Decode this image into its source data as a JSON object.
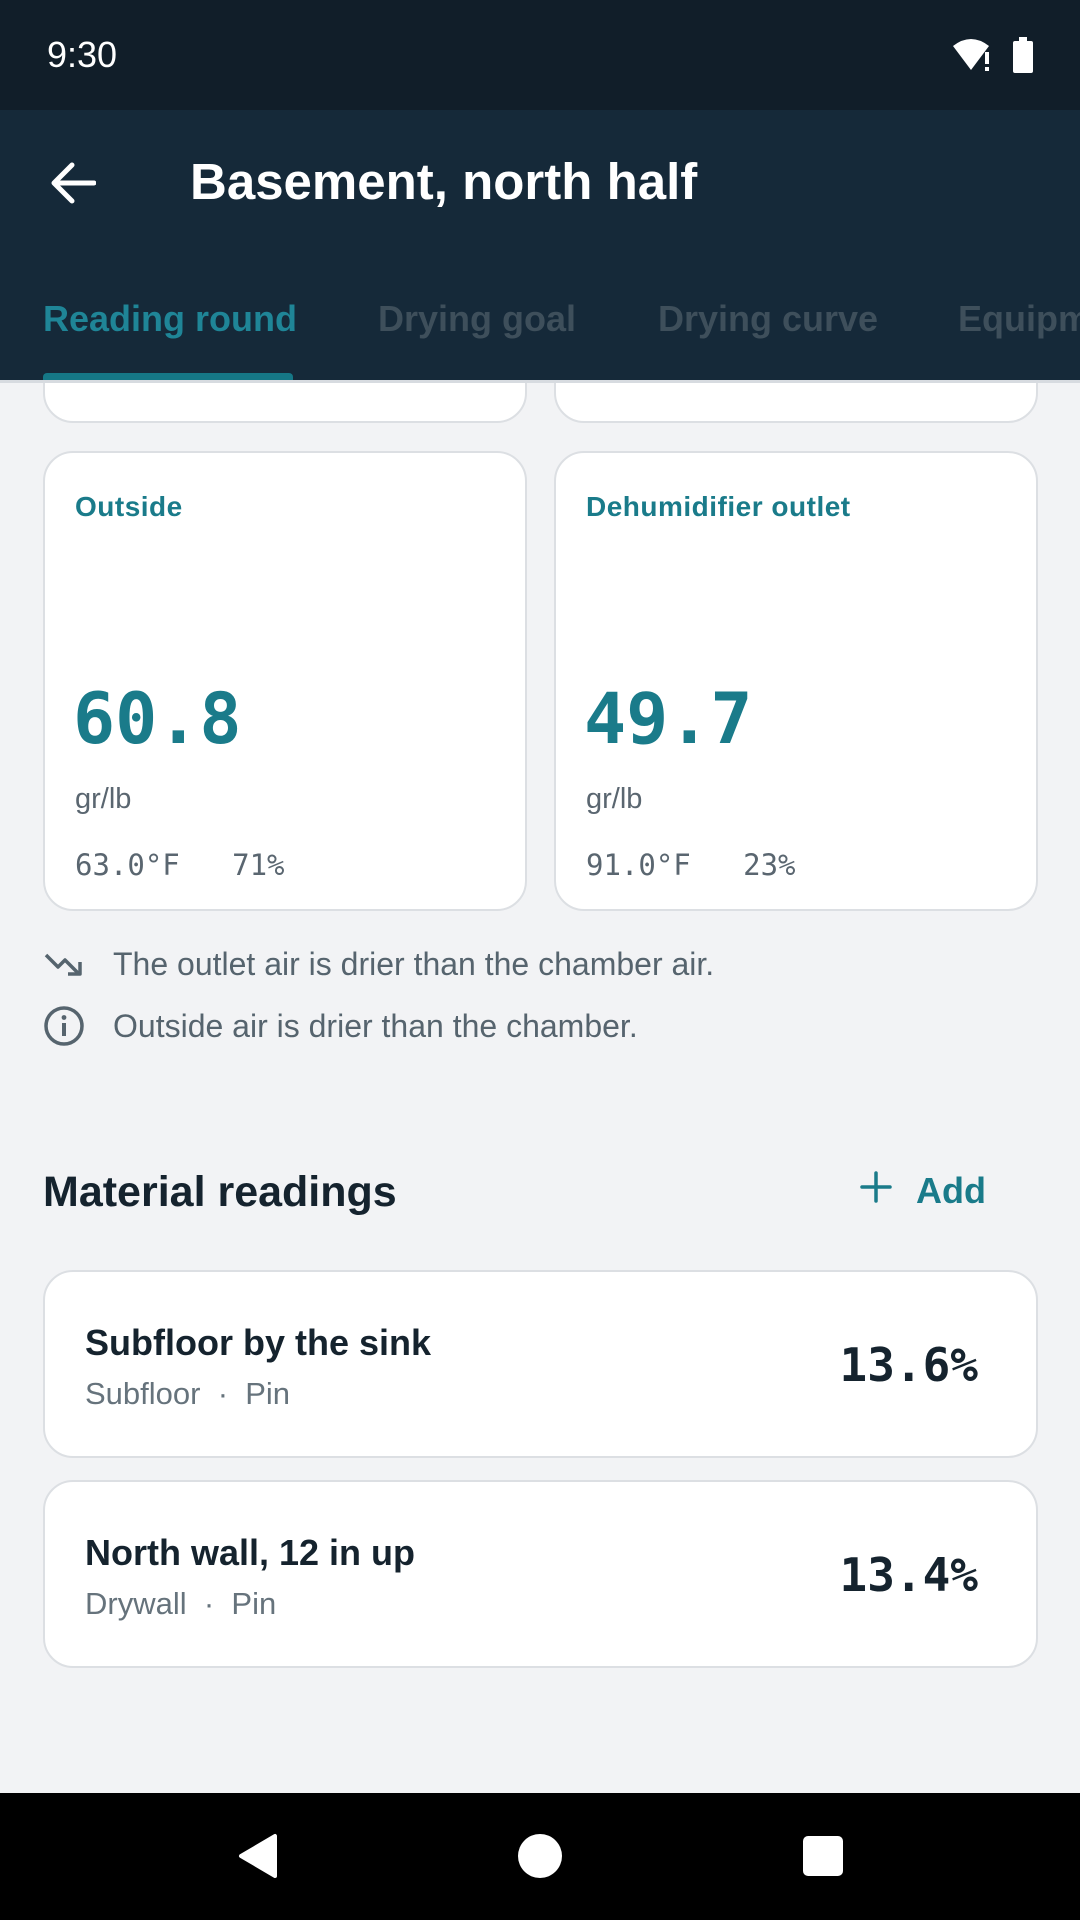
{
  "status_bar": {
    "time": "9:30",
    "icons": [
      "wifi-alert-icon",
      "battery-icon"
    ]
  },
  "app_bar": {
    "back_icon": "arrow-left-icon",
    "title": "Basement, north half"
  },
  "tabs": [
    {
      "label": "Reading round",
      "active": true
    },
    {
      "label": "Drying goal",
      "active": false
    },
    {
      "label": "Drying curve",
      "active": false
    },
    {
      "label": "Equipm",
      "active": false
    }
  ],
  "environment_cards": [
    {
      "label": "Outside",
      "value": "60.8",
      "unit": "gr/lb",
      "meta": "63.0°F   71%"
    },
    {
      "label": "Dehumidifier outlet",
      "value": "49.7",
      "unit": "gr/lb",
      "meta": "91.0°F   23%"
    }
  ],
  "notes": [
    {
      "icon": "trending-down-icon",
      "text": "The outlet air is drier than the chamber air."
    },
    {
      "icon": "info-icon",
      "text": "Outside air is drier than the chamber."
    }
  ],
  "material_section": {
    "title": "Material readings",
    "add_label": "Add",
    "add_icon": "plus-icon",
    "items": [
      {
        "name": "Subfloor by the sink",
        "sub": "Subfloor  ·  Pin",
        "value": "13.6%"
      },
      {
        "name": "North wall, 12 in up",
        "sub": "Drywall  ·  Pin",
        "value": "13.4%"
      }
    ]
  },
  "colors": {
    "accent": "#1a7b8a",
    "app_bar": "#152939",
    "status_bar": "#111e29",
    "background": "#f2f3f5"
  }
}
